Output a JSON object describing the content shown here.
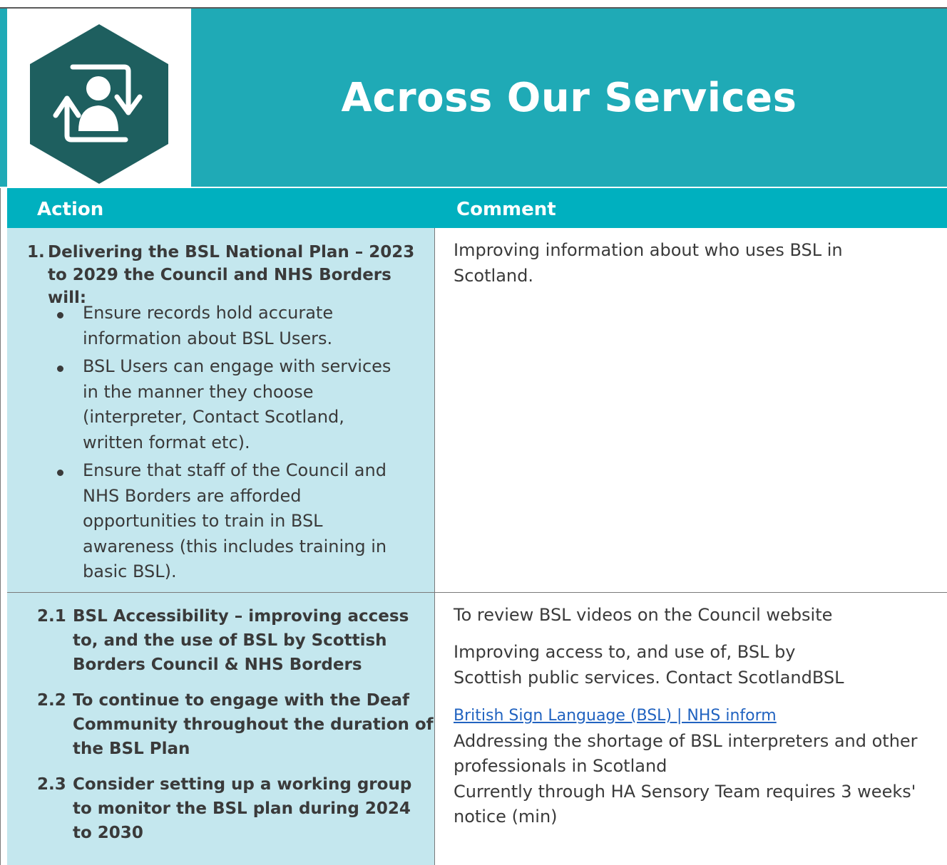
{
  "header": {
    "title": "Across Our Services",
    "logo_icon": "person-cycle-icon",
    "colors": {
      "band": "#1faab6",
      "hexagon": "#1e5f5f"
    }
  },
  "table": {
    "columns": {
      "action": "Action",
      "comment": "Comment"
    },
    "row1": {
      "number": "1.",
      "heading": "Delivering the BSL National Plan – 2023 to 2029 the Council and NHS Borders will:",
      "bullets": [
        "Ensure records hold accurate information about BSL Users.",
        "BSL Users can engage with services in the manner they choose (interpreter, Contact Scotland, written format etc).",
        "Ensure that staff of the Council and NHS Borders are afforded opportunities to train in BSL awareness (this includes training in basic BSL)."
      ],
      "comment": "Improving information about who uses BSL in Scotland."
    },
    "row2": {
      "items": [
        {
          "number": "2.1",
          "text": "BSL Accessibility – improving access to, and the use of BSL by Scottish Borders Council & NHS Borders"
        },
        {
          "number": "2.2",
          "text": "To continue to engage with the Deaf Community throughout the duration of the BSL Plan"
        },
        {
          "number": "2.3",
          "text": "Consider setting up a working group to monitor the BSL plan during 2024 to 2030"
        }
      ],
      "comments": {
        "c1": "To review BSL videos on the Council website",
        "c2": "Improving access to, and use of, BSL by Scottish public services. Contact ScotlandBSL",
        "link": "British Sign Language (BSL) | NHS inform",
        "c3": "Addressing the shortage of BSL interpreters and other professionals in Scotland",
        "c4": "Currently through HA Sensory Team requires 3 weeks' notice (min)"
      }
    }
  }
}
